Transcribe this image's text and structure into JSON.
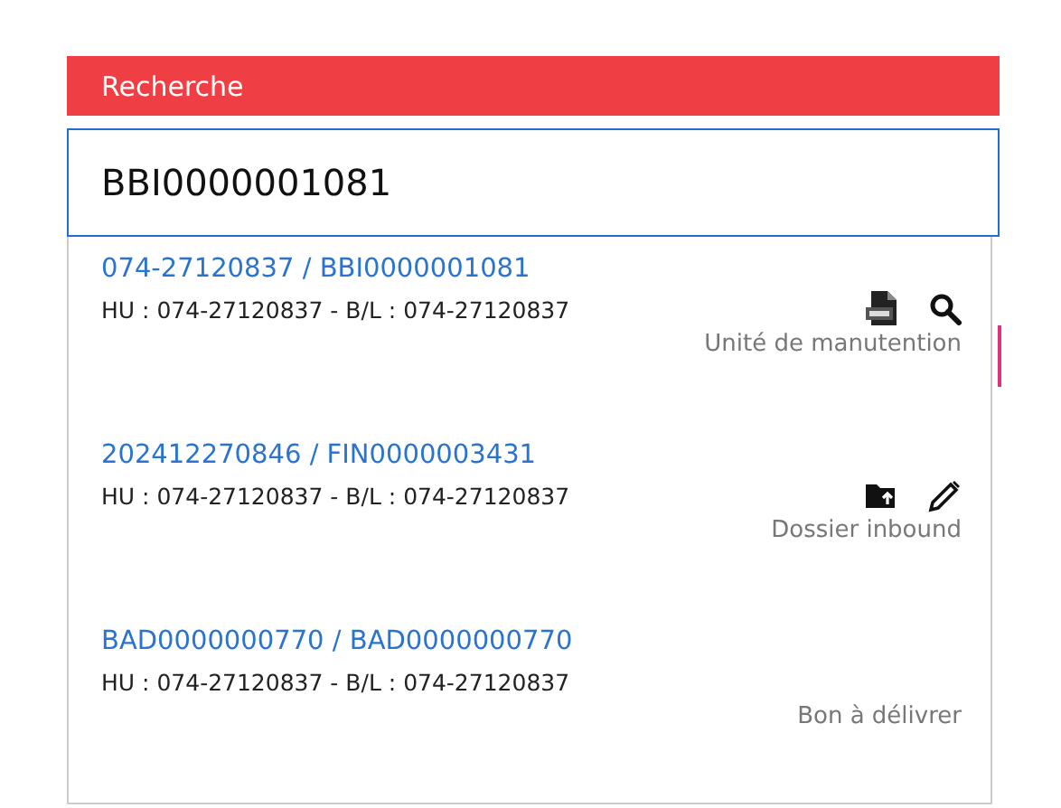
{
  "header": {
    "title": "Recherche"
  },
  "search": {
    "value": "BBI0000001081"
  },
  "results": [
    {
      "title": "074-27120837 / BBI0000001081",
      "detail": "HU : 074-27120837 - B/L : 074-27120837",
      "type": "Unité de manutention",
      "actions": [
        {
          "kind": "pdf"
        },
        {
          "kind": "search"
        }
      ]
    },
    {
      "title": "202412270846 / FIN0000003431",
      "detail": "HU : 074-27120837 - B/L : 074-27120837",
      "type": "Dossier inbound",
      "actions": [
        {
          "kind": "folder-upload"
        },
        {
          "kind": "edit"
        }
      ]
    },
    {
      "title": "BAD0000000770 / BAD0000000770",
      "detail": "HU : 074-27120837 - B/L : 074-27120837",
      "type": "Bon à délivrer"
    }
  ]
}
